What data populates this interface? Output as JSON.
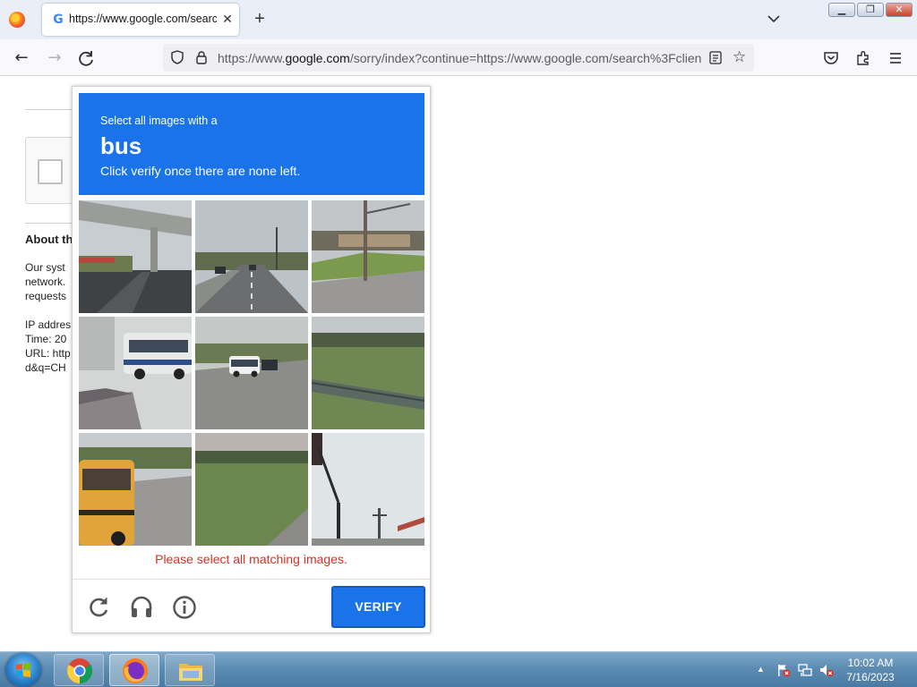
{
  "browser": {
    "tab": {
      "title": "https://www.google.com/search",
      "favicon": "G"
    },
    "url": {
      "prefix": "https://www.",
      "domain": "google.com",
      "rest": "/sorry/index?continue=https://www.google.com/search%3Fclien"
    },
    "icons": [
      "firefox-menu-icon",
      "back-icon",
      "forward-icon",
      "reload-icon",
      "shield-icon",
      "lock-icon",
      "reader-view-icon",
      "bookmark-star-icon",
      "pocket-icon",
      "extensions-icon",
      "hamburger-menu-icon"
    ]
  },
  "page_behind": {
    "heading": "About th",
    "lines": [
      "Our syst",
      "network.",
      "requests"
    ],
    "info": [
      "IP addres",
      "Time: 20",
      "URL: http",
      "d&q=CH"
    ]
  },
  "captcha": {
    "instruction_top": "Select all images with a",
    "keyword": "bus",
    "instruction_bottom": "Click verify once there are none left.",
    "error": "Please select all matching images.",
    "verify_label": "VERIFY",
    "header_color": "#1a73e8",
    "error_color": "#d93025",
    "tiles": [
      "overpass-road",
      "street-traffic",
      "parking-lot-pole",
      "white-bus",
      "street-bus-distant",
      "grass-guardrail",
      "school-bus",
      "grass-roadside",
      "sky-streetlight"
    ],
    "footer_icons": [
      "reload-icon",
      "audio-headphones-icon",
      "info-icon"
    ]
  },
  "taskbar": {
    "apps": [
      "chrome-icon",
      "firefox-icon",
      "file-explorer-icon"
    ],
    "tray_icons": [
      "action-center-flag-icon",
      "network-icon",
      "volume-muted-icon"
    ],
    "time": "10:02 AM",
    "date": "7/16/2023"
  }
}
